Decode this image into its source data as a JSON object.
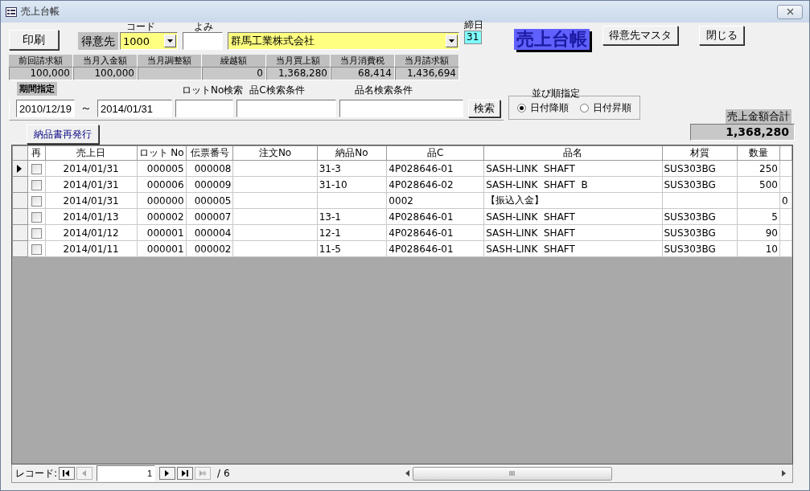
{
  "window": {
    "title": "売上台帳"
  },
  "print_button": "印刷",
  "customer": {
    "label": "得意先",
    "code_label": "コード",
    "code": "1000",
    "yomi_label": "よみ",
    "name": "群馬工業株式会社",
    "closing_day_label": "締日",
    "closing_day": "31"
  },
  "form_title": "売上台帳",
  "buttons": [
    "得意先マスタ",
    "閉じる"
  ],
  "summary": [
    {
      "label": "前回請求額",
      "value": "100,000"
    },
    {
      "label": "当月入金額",
      "value": "100,000"
    },
    {
      "label": "当月調整額"
    },
    {
      "label": "繰越額",
      "value": "0"
    },
    {
      "label": "当月買上額",
      "value": "1,368,280"
    },
    {
      "label": "当月消費税",
      "value": "68,414"
    },
    {
      "label": "当月請求額",
      "value": "1,436,694"
    }
  ],
  "filters": {
    "period_label": "期間指定",
    "from": "2010/12/19",
    "separator": "～",
    "to": "2014/01/31",
    "lot_label": "ロットNo検索",
    "code_label": "品C検索条件",
    "name_label": "品名検索条件",
    "search_button": "検索"
  },
  "sort": {
    "label": "並び順指定",
    "options": [
      {
        "label": "日付降順",
        "selected": true
      },
      {
        "label": "日付昇順",
        "selected": false
      }
    ]
  },
  "reissue_button": "納品書再発行",
  "total": {
    "label": "売上金額合計",
    "value": "1,368,280"
  },
  "table": {
    "columns": [
      "再",
      "売上日",
      "ロット No",
      "伝票番号",
      "注文No",
      "納品No",
      "品C",
      "品名",
      "材質",
      "数量"
    ],
    "rows": [
      {
        "current": true,
        "checked": false,
        "date": "2014/01/31",
        "lot_no": "000005",
        "slip_no": "000008",
        "delivery_no": "31-3",
        "item_code": "4P028646-01",
        "item_name": "SASH-LINK  SHAFT",
        "material": "SUS303BG",
        "quantity": "250"
      },
      {
        "current": false,
        "checked": false,
        "date": "2014/01/31",
        "lot_no": "000006",
        "slip_no": "000009",
        "delivery_no": "31-10",
        "item_code": "4P028646-02",
        "item_name": "SASH-LINK  SHAFT  B",
        "material": "SUS303BG",
        "quantity": "500"
      },
      {
        "current": false,
        "checked": false,
        "date": "2014/01/31",
        "lot_no": "000000",
        "slip_no": "000005",
        "item_code": "0002",
        "item_name": "【振込入金】",
        "column_11": "0"
      },
      {
        "current": false,
        "checked": false,
        "date": "2014/01/13",
        "lot_no": "000002",
        "slip_no": "000007",
        "delivery_no": "13-1",
        "item_code": "4P028646-01",
        "item_name": "SASH-LINK  SHAFT",
        "material": "SUS303BG",
        "quantity": "5"
      },
      {
        "current": false,
        "checked": false,
        "date": "2014/01/12",
        "lot_no": "000001",
        "slip_no": "000004",
        "delivery_no": "12-1",
        "item_code": "4P028646-01",
        "item_name": "SASH-LINK  SHAFT",
        "material": "SUS303BG",
        "quantity": "90"
      },
      {
        "current": false,
        "checked": false,
        "date": "2014/01/11",
        "lot_no": "000001",
        "slip_no": "000002",
        "delivery_no": "11-5",
        "item_code": "4P028646-01",
        "item_name": "SASH-LINK  SHAFT",
        "material": "SUS303BG",
        "quantity": "10"
      }
    ]
  },
  "navigation": {
    "label": "レコード:",
    "buttons": [
      {
        "kind": "first",
        "disabled": false
      },
      {
        "kind": "prev",
        "disabled": true
      }
    ],
    "current": "1",
    "buttons_after": [
      {
        "kind": "next",
        "disabled": false
      },
      {
        "kind": "last",
        "disabled": false
      },
      {
        "kind": "new",
        "disabled": true
      }
    ],
    "total": "/ 6"
  }
}
